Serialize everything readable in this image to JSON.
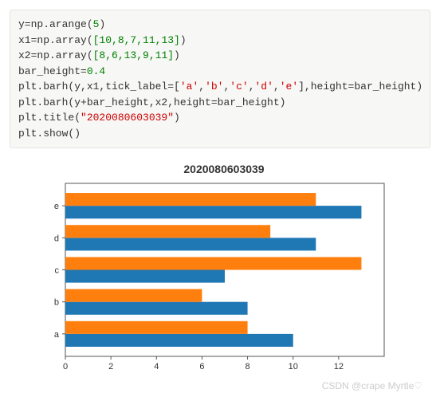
{
  "code": {
    "l1a": "y=np.arange(",
    "l1b": "5",
    "l1c": ")",
    "l2a": "x1=np.array(",
    "l2b": "[10,8,7,11,13]",
    "l2c": ")",
    "l3a": "x2=np.array(",
    "l3b": "[8,6,13,9,11]",
    "l3c": ")",
    "l4a": "bar_height=",
    "l4b": "0.4",
    "l5a": "plt.barh(y,x1,tick_label=[",
    "l5b": "'a'",
    "l5c": ",",
    "l5d": "'b'",
    "l5e": ",",
    "l5f": "'c'",
    "l5g": ",",
    "l5h": "'d'",
    "l5i": ",",
    "l5j": "'e'",
    "l5k": "],height=bar_height)",
    "l6": "plt.barh(y+bar_height,x2,height=bar_height)",
    "l7a": "plt.title(",
    "l7b": "\"2020080603039\"",
    "l7c": ")",
    "l8": "plt.show()"
  },
  "chart_data": {
    "type": "bar",
    "orientation": "horizontal",
    "title": "2020080603039",
    "categories": [
      "a",
      "b",
      "c",
      "d",
      "e"
    ],
    "series": [
      {
        "name": "x1",
        "values": [
          10,
          8,
          7,
          11,
          13
        ],
        "color": "#1f77b4"
      },
      {
        "name": "x2",
        "values": [
          8,
          6,
          13,
          9,
          11
        ],
        "color": "#ff7f0e"
      }
    ],
    "x_ticks": [
      0,
      2,
      4,
      6,
      8,
      10,
      12
    ],
    "xlim": [
      0,
      14
    ],
    "bar_height": 0.4
  },
  "watermark": "CSDN @crape Myrtle♡"
}
